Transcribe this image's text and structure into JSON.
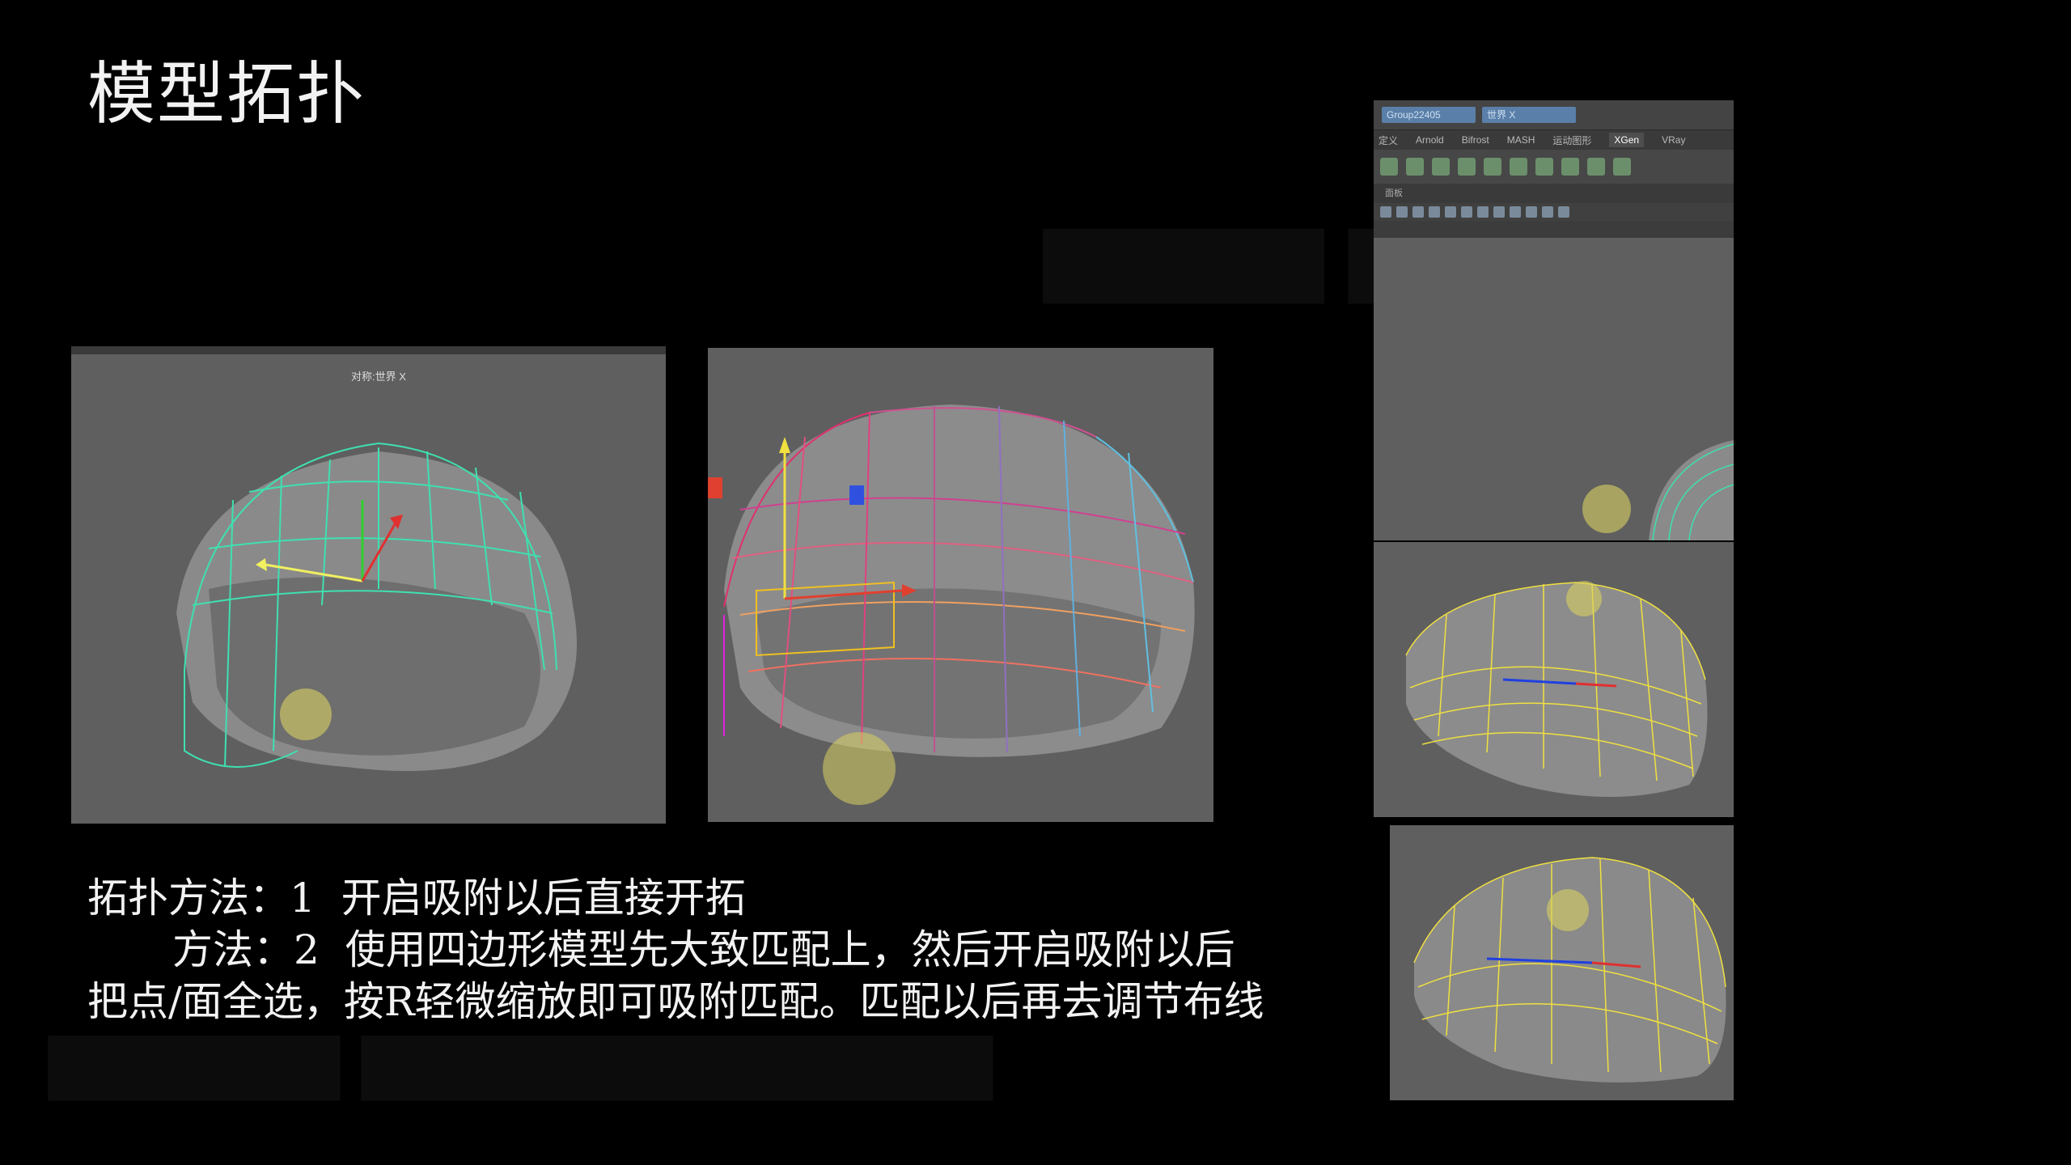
{
  "slide": {
    "title": "模型拓扑",
    "method_line_1": "拓扑方法：1  开启吸附以后直接开拓",
    "method_line_2": "方法：2  使用四边形模型先大致匹配上，然后开启吸附以后",
    "method_line_3": "把点/面全选，按R轻微缩放即可吸附匹配。匹配以后再去调节布线"
  },
  "screenshot_1": {
    "viewport_label": "对称:世界 X"
  },
  "screenshot_3": {
    "object_field": "Group22405",
    "symmetry_field": "世界 X",
    "tabs": [
      "定义",
      "Arnold",
      "Bifrost",
      "MASH",
      "运动图形",
      "XGen",
      "VRay"
    ],
    "active_tab": "XGen",
    "panel_label": "面板"
  },
  "colors": {
    "background": "#000000",
    "viewport_gray": "#5f5f5f",
    "wire_cyan": "#3fe0b0",
    "wire_yellow": "#f0e040",
    "cursor_highlight": "#d8d060"
  }
}
